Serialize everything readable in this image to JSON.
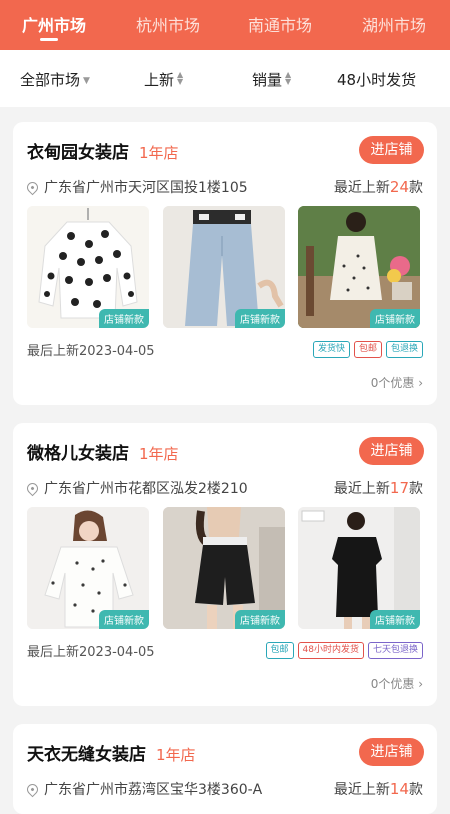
{
  "tabs": [
    "广州市场",
    "杭州市场",
    "南通市场",
    "湖州市场"
  ],
  "filters": {
    "all_market": "全部市场",
    "new": "上新",
    "sales": "销量",
    "ship48": "48小时发货"
  },
  "colors": {
    "accent": "#f2684e",
    "tag_teal": "#3fb8b0"
  },
  "shops": [
    {
      "name": "衣甸园女装店",
      "age": "1年店",
      "enter_label": "进店铺",
      "address": "广东省广州市天河区国投1楼105",
      "recent_prefix": "最近上新",
      "recent_count": "24",
      "recent_unit": "款",
      "photo_tags": [
        "店铺新款",
        "店铺新款",
        "店铺新款"
      ],
      "last_update": "最后上新2023-04-05",
      "service_tags": [
        "发货快",
        "包邮",
        "包退换"
      ],
      "offers": "0个优惠"
    },
    {
      "name": "微格儿女装店",
      "age": "1年店",
      "enter_label": "进店铺",
      "address": "广东省广州市花都区泓发2楼210",
      "recent_prefix": "最近上新",
      "recent_count": "17",
      "recent_unit": "款",
      "photo_tags": [
        "店铺新款",
        "店铺新款",
        "店铺新款"
      ],
      "last_update": "最后上新2023-04-05",
      "service_tags": [
        "包邮",
        "48小时内发货",
        "七天包退换"
      ],
      "offers": "0个优惠"
    },
    {
      "name": "天衣无缝女装店",
      "age": "1年店",
      "enter_label": "进店铺",
      "address": "广东省广州市荔湾区宝华3楼360-A",
      "recent_prefix": "最近上新",
      "recent_count": "14",
      "recent_unit": "款"
    }
  ]
}
